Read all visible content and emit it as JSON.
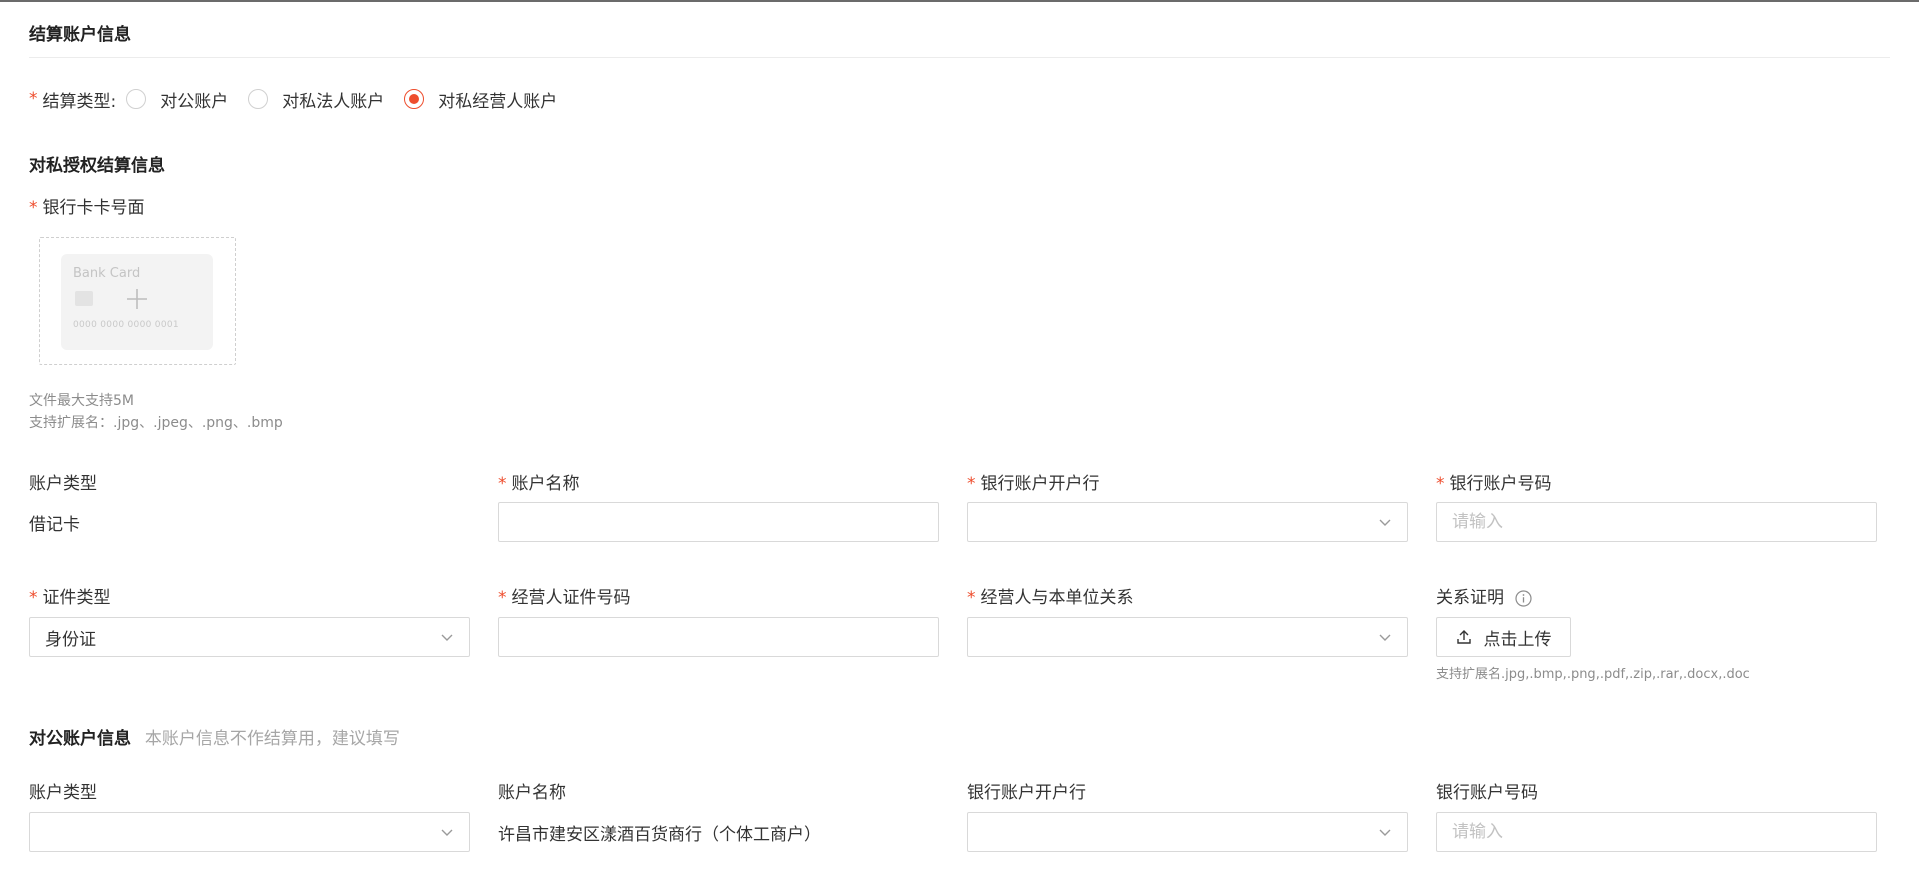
{
  "section_settlement": {
    "title": "结算账户信息"
  },
  "settlement_type": {
    "label": "结算类型:",
    "options": [
      {
        "label": "对公账户",
        "checked": false
      },
      {
        "label": "对私法人账户",
        "checked": false
      },
      {
        "label": "对私经营人账户",
        "checked": true
      }
    ]
  },
  "private_section": {
    "title": "对私授权结算信息"
  },
  "bank_card_upload": {
    "label": "银行卡卡号面",
    "card_title": "Bank Card",
    "card_number": "0000 0000 0000 0001",
    "hint_size": "文件最大支持5M",
    "hint_ext": "支持扩展名：.jpg、.jpeg、.png、.bmp"
  },
  "private_fields": {
    "account_type_label": "账户类型",
    "account_type_value": "借记卡",
    "account_name_label": "账户名称",
    "account_name_value": "",
    "bank_label": "银行账户开户行",
    "bank_value": "",
    "account_number_label": "银行账户号码",
    "account_number_placeholder": "请输入",
    "cert_type_label": "证件类型",
    "cert_type_value": "身份证",
    "cert_number_label": "经营人证件号码",
    "cert_number_value": "",
    "relation_label": "经营人与本单位关系",
    "relation_value": "",
    "proof_label": "关系证明",
    "upload_button": "点击上传",
    "proof_hint": "支持扩展名.jpg,.bmp,.png,.pdf,.zip,.rar,.docx,.doc"
  },
  "public_section": {
    "title": "对公账户信息",
    "subtitle": "本账户信息不作结算用，建议填写",
    "account_type_label": "账户类型",
    "account_type_value": "",
    "account_name_label": "账户名称",
    "account_name_value": "许昌市建安区漾酒百货商行（个体工商户）",
    "bank_label": "银行账户开户行",
    "bank_value": "",
    "account_number_label": "银行账户号码",
    "account_number_placeholder": "请输入"
  },
  "colors": {
    "accent": "#ee4d2d",
    "border": "#d9d9d9",
    "hint": "#8c8c8c"
  }
}
